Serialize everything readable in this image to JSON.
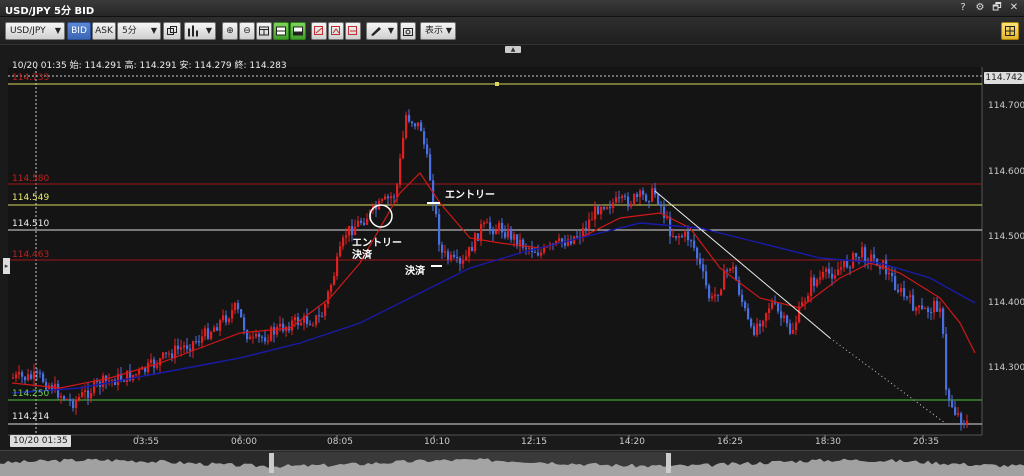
{
  "window": {
    "title": "USD/JPY 5分 BID",
    "controls": [
      "?",
      "⚙",
      "🗗",
      "✕"
    ]
  },
  "toolbar": {
    "symbol": "USD/JPY",
    "bid_label": "BID",
    "ask_label": "ASK",
    "timeframe": "5分",
    "display_label": "表示"
  },
  "ohlc": {
    "text": "10/20 01:35  始: 114.291  高: 114.291  安: 114.279  終: 114.283"
  },
  "price_axis": {
    "ticks": [
      "114.700",
      "114.600",
      "114.500",
      "114.400",
      "114.300"
    ],
    "current_price": "114.742"
  },
  "horizontal_lines": {
    "red_top": "114.580",
    "yellow_mid": "114.549",
    "white_mid": "114.510",
    "red_low": "114.463",
    "green_low": "114.250",
    "white_low": "114.214",
    "top_line": "114.733"
  },
  "time_axis": {
    "start_label": "10/20 01:35",
    "ticks": [
      "03:55",
      "06:00",
      "08:05",
      "10:10",
      "12:15",
      "14:20",
      "16:25",
      "18:30",
      "20:35"
    ]
  },
  "annotations": {
    "entry_1": "エントリー",
    "settle_1": "決済",
    "entry_2": "エントリー",
    "settle_2": "決済"
  },
  "colors": {
    "up": "#e02020",
    "down": "#4a6fe0",
    "ma_short": "#d01818",
    "ma_long": "#1a1aa8",
    "yellow_line": "#d8d860",
    "red_line": "#a01818",
    "green_line": "#50c040"
  }
}
